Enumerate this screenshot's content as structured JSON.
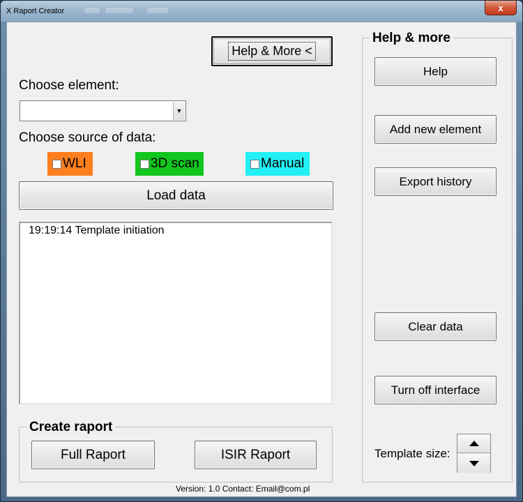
{
  "window": {
    "title": "X Raport Creator",
    "close_glyph": "x"
  },
  "main": {
    "help_more_toggle_label": "Help & More <",
    "choose_element_label": "Choose element:",
    "element_combo_value": "",
    "choose_source_label": "Choose source of data:",
    "sources": [
      {
        "label": "WLI",
        "color": "#ff7f1e",
        "checked": false
      },
      {
        "label": "3D scan",
        "color": "#11c61d",
        "checked": false
      },
      {
        "label": "Manual",
        "color": "#22f0f4",
        "checked": false
      }
    ],
    "load_button_label": "Load data",
    "log_entries": [
      "19:19:14  Template initiation"
    ]
  },
  "create_raport": {
    "title": "Create raport",
    "full_button_label": "Full Raport",
    "isir_button_label": "ISIR Raport"
  },
  "help_panel": {
    "title": "Help & more",
    "help_button_label": "Help",
    "add_element_button_label": "Add new element",
    "export_history_button_label": "Export history",
    "clear_data_button_label": "Clear data",
    "turn_off_button_label": "Turn off interface",
    "template_size_label": "Template size:",
    "spin_up_icon": "triangle-up",
    "spin_down_icon": "triangle-down"
  },
  "footer": {
    "version_text": "Version: 1.0 Contact: Email@com.pl"
  }
}
